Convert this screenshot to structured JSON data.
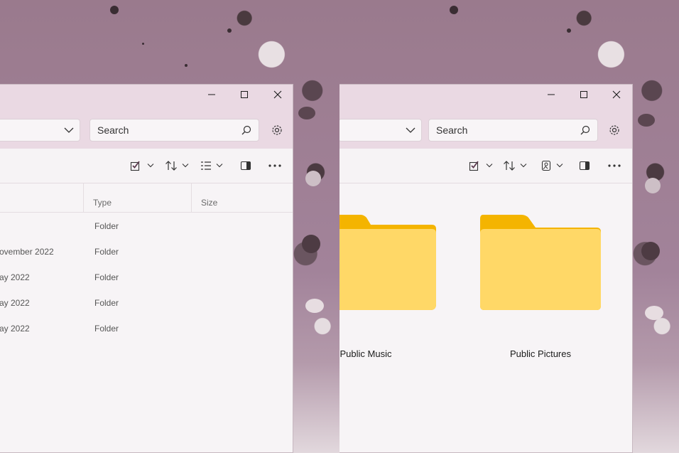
{
  "left_window": {
    "search_placeholder": "Search",
    "columns": [
      "Type",
      "Size"
    ],
    "rows": [
      {
        "date": "",
        "type": "Folder"
      },
      {
        "date": "ovember 2022",
        "type": "Folder"
      },
      {
        "date": "ay 2022",
        "type": "Folder"
      },
      {
        "date": "ay 2022",
        "type": "Folder"
      },
      {
        "date": "ay 2022",
        "type": "Folder"
      }
    ]
  },
  "right_window": {
    "search_placeholder": "Search",
    "folders": [
      {
        "label": "Public Music"
      },
      {
        "label": "Public Pictures"
      }
    ]
  },
  "icons": {
    "minimize": "minimize-icon",
    "maximize": "maximize-icon",
    "close": "close-icon",
    "search": "search-icon",
    "settings": "gear-icon",
    "select": "checkbox-select-icon",
    "sort": "sort-icon",
    "view": "view-details-icon",
    "preview": "details-pane-icon",
    "more": "more-icon",
    "folder": "folder-icon"
  },
  "colors": {
    "titlebar": "#ead9e3",
    "content": "#f7f4f6",
    "folder_front": "#ffd45e",
    "folder_back": "#f4b400"
  }
}
